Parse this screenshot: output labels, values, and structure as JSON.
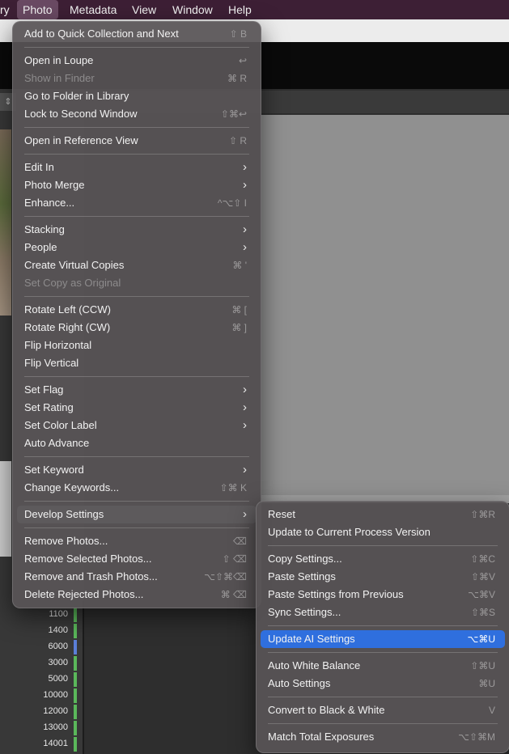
{
  "menubar": {
    "items": [
      "ry",
      "Photo",
      "Metadata",
      "View",
      "Window",
      "Help"
    ]
  },
  "left_panel": {
    "toolbar_icon": "⇕",
    "values": [
      {
        "label": "1100",
        "color": "#5ab85a"
      },
      {
        "label": "1400",
        "color": "#5ab85a"
      },
      {
        "label": "6000",
        "color": "#5b7fd8"
      },
      {
        "label": "3000",
        "color": "#5ab85a"
      },
      {
        "label": "5000",
        "color": "#5ab85a"
      },
      {
        "label": "10000",
        "color": "#5ab85a"
      },
      {
        "label": "12000",
        "color": "#5ab85a"
      },
      {
        "label": "13000",
        "color": "#5ab85a"
      },
      {
        "label": "14001",
        "color": "#5ab85a"
      }
    ]
  },
  "photo_menu": {
    "items": [
      {
        "label": "Add to Quick Collection and Next",
        "shortcut": "⇧ B"
      },
      {
        "label": "Open in Loupe",
        "shortcut": "↩"
      },
      {
        "label": "Show in Finder",
        "shortcut": "⌘ R",
        "disabled": true
      },
      {
        "label": "Go to Folder in Library",
        "shortcut": ""
      },
      {
        "label": "Lock to Second Window",
        "shortcut": "⇧⌘↩"
      },
      {
        "label": "Open in Reference View",
        "shortcut": "⇧ R"
      },
      {
        "label": "Edit In",
        "submenu": true
      },
      {
        "label": "Photo Merge",
        "submenu": true
      },
      {
        "label": "Enhance...",
        "shortcut": "^⌥⇧ I"
      },
      {
        "label": "Stacking",
        "submenu": true
      },
      {
        "label": "People",
        "submenu": true
      },
      {
        "label": "Create Virtual Copies",
        "shortcut": "⌘ '"
      },
      {
        "label": "Set Copy as Original",
        "shortcut": "",
        "disabled": true
      },
      {
        "label": "Rotate Left (CCW)",
        "shortcut": "⌘ ["
      },
      {
        "label": "Rotate Right (CW)",
        "shortcut": "⌘ ]"
      },
      {
        "label": "Flip Horizontal",
        "shortcut": ""
      },
      {
        "label": "Flip Vertical",
        "shortcut": ""
      },
      {
        "label": "Set Flag",
        "submenu": true
      },
      {
        "label": "Set Rating",
        "submenu": true
      },
      {
        "label": "Set Color Label",
        "submenu": true
      },
      {
        "label": "Auto Advance",
        "shortcut": ""
      },
      {
        "label": "Set Keyword",
        "submenu": true
      },
      {
        "label": "Change Keywords...",
        "shortcut": "⇧⌘ K"
      },
      {
        "label": "Develop Settings",
        "submenu": true,
        "highlighted": true
      },
      {
        "label": "Remove Photos...",
        "shortcut": "⌫"
      },
      {
        "label": "Remove Selected Photos...",
        "shortcut": "⇧ ⌫"
      },
      {
        "label": "Remove and Trash Photos...",
        "shortcut": "⌥⇧⌘⌫"
      },
      {
        "label": "Delete Rejected Photos...",
        "shortcut": "⌘ ⌫"
      }
    ]
  },
  "develop_submenu": {
    "items": [
      {
        "label": "Reset",
        "shortcut": "⇧⌘R"
      },
      {
        "label": "Update to Current Process Version",
        "shortcut": ""
      },
      {
        "label": "Copy Settings...",
        "shortcut": "⇧⌘C"
      },
      {
        "label": "Paste Settings",
        "shortcut": "⇧⌘V"
      },
      {
        "label": "Paste Settings from Previous",
        "shortcut": "⌥⌘V"
      },
      {
        "label": "Sync Settings...",
        "shortcut": "⇧⌘S"
      },
      {
        "label": "Update AI Settings",
        "shortcut": "⌥⌘U",
        "selected": true
      },
      {
        "label": "Auto White Balance",
        "shortcut": "⇧⌘U"
      },
      {
        "label": "Auto Settings",
        "shortcut": "⌘U"
      },
      {
        "label": "Convert to Black & White",
        "shortcut": "V"
      },
      {
        "label": "Match Total Exposures",
        "shortcut": "⌥⇧⌘M"
      }
    ]
  },
  "colors": {
    "menubar_bg": "#3d1f35",
    "menu_bg": "#585456",
    "selection": "#2f6fde",
    "highlight": "#5d5a5c"
  }
}
